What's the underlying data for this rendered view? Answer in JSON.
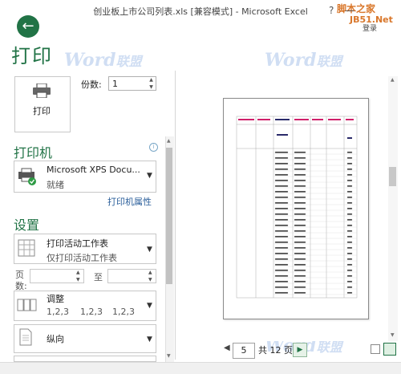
{
  "window": {
    "title": "创业板上市公司列表.xls [兼容模式] - Microsoft Excel",
    "help": "?",
    "minimize": "—",
    "login": "登录"
  },
  "watermark": {
    "word": "Word",
    "cn": "联盟",
    "brand_top": "脚本之家",
    "brand_bottom": "JB51.Net"
  },
  "backstage": {
    "title": "打印",
    "print_button": "打印",
    "copies_label": "份数:",
    "copies_value": "1"
  },
  "printer": {
    "section": "打印机",
    "info": "i",
    "name": "Microsoft XPS Docu...",
    "status": "就绪",
    "properties_link": "打印机属性"
  },
  "settings": {
    "section": "设置",
    "scope_title": "打印活动工作表",
    "scope_sub": "仅打印活动工作表",
    "pages_label_1": "页",
    "pages_label_2": "数:",
    "to_label": "至",
    "collate_title": "调整",
    "collate_seq": [
      "1,2,3",
      "1,2,3",
      "1,2,3"
    ],
    "orientation": "纵向"
  },
  "preview": {
    "current_page": "5",
    "total_pages": "共 12 页"
  },
  "colors": {
    "accent": "#217346",
    "link": "#2a5e9a"
  }
}
